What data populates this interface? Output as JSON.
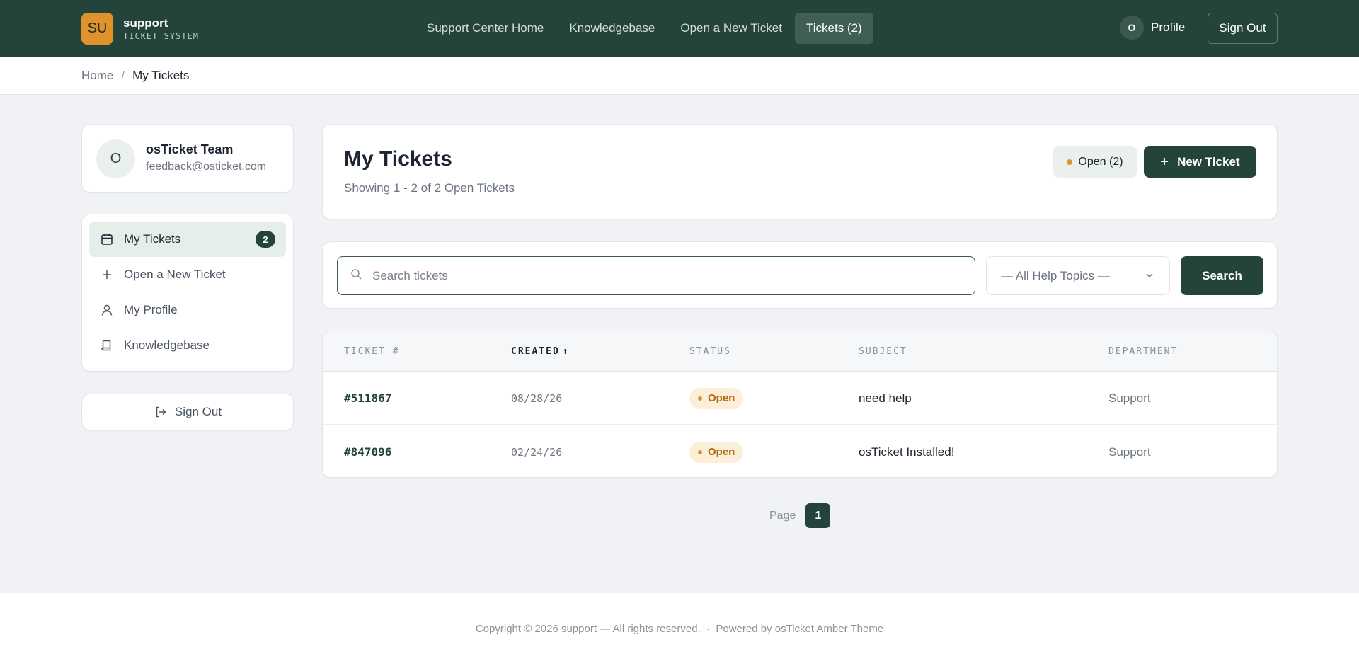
{
  "colors": {
    "brand_dark": "#24443b",
    "accent_amber": "#e0922b",
    "page_bg": "#f1f2f5"
  },
  "header": {
    "logo_initials": "SU",
    "brand_name": "support",
    "brand_sub": "TICKET SYSTEM",
    "nav": [
      {
        "label": "Support Center Home",
        "active": false
      },
      {
        "label": "Knowledgebase",
        "active": false
      },
      {
        "label": "Open a New Ticket",
        "active": false
      },
      {
        "label": "Tickets (2)",
        "active": true
      }
    ],
    "profile_initial": "O",
    "profile_label": "Profile",
    "signout_label": "Sign Out"
  },
  "breadcrumb": {
    "home": "Home",
    "separator": "/",
    "current": "My Tickets"
  },
  "user": {
    "initial": "O",
    "name": "osTicket Team",
    "email": "feedback@osticket.com"
  },
  "sidebar": {
    "items": [
      {
        "label": "My Tickets",
        "icon": "calendar-icon",
        "active": true,
        "badge": "2"
      },
      {
        "label": "Open a New Ticket",
        "icon": "plus-icon",
        "active": false
      },
      {
        "label": "My Profile",
        "icon": "user-icon",
        "active": false
      },
      {
        "label": "Knowledgebase",
        "icon": "book-icon",
        "active": false
      }
    ],
    "signout_label": "Sign Out"
  },
  "main": {
    "title": "My Tickets",
    "subtitle": "Showing 1 - 2 of 2 Open Tickets",
    "open_filter_label": "Open (2)",
    "new_ticket_label": "New Ticket"
  },
  "search": {
    "placeholder": "Search tickets",
    "value": "",
    "topic_selected": "— All Help Topics —",
    "button_label": "Search"
  },
  "table": {
    "columns": [
      "TICKET #",
      "CREATED",
      "STATUS",
      "SUBJECT",
      "DEPARTMENT"
    ],
    "sorted_column": "CREATED",
    "sort_direction": "ascending",
    "rows": [
      {
        "number": "#511867",
        "created": "08/28/26",
        "status": "Open",
        "subject": "need help",
        "department": "Support"
      },
      {
        "number": "#847096",
        "created": "02/24/26",
        "status": "Open",
        "subject": "osTicket Installed!",
        "department": "Support"
      }
    ]
  },
  "pagination": {
    "label": "Page",
    "current": "1"
  },
  "footer": {
    "text": "Copyright © 2026 support — All rights reserved.  ·  Powered by osTicket Amber Theme"
  }
}
